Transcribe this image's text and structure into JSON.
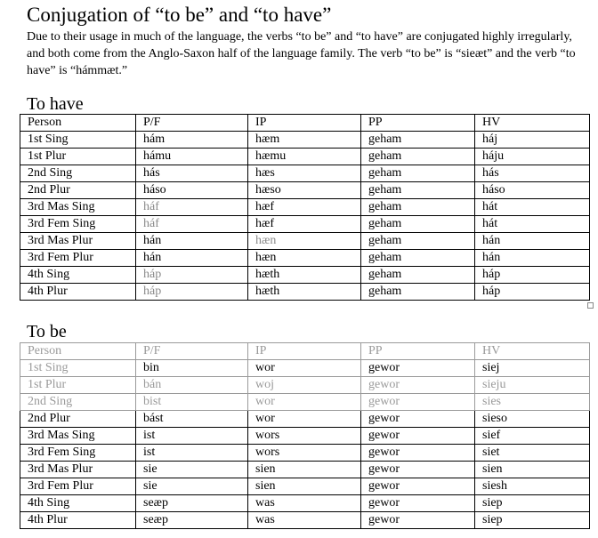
{
  "document": {
    "title": "Conjugation of “to be” and “to have”",
    "intro": "Due to their usage in much of the language, the verbs “to be” and “to have” are conjugated highly irregularly, and both come from the Anglo-Saxon half of the language family. The verb “to be” is “sieæt” and the verb “to have” is “hámmæt.”"
  },
  "tables": [
    {
      "title": "To have",
      "headers": [
        "Person",
        "P/F",
        "IP",
        "PP",
        "HV"
      ],
      "rows": [
        [
          "1st Sing",
          "hám",
          "hæm",
          "geham",
          "háj"
        ],
        [
          "1st Plur",
          "hámu",
          "hæmu",
          "geham",
          "háju"
        ],
        [
          "2nd Sing",
          "hás",
          "hæs",
          "geham",
          "hás"
        ],
        [
          "2nd Plur",
          "háso",
          "hæso",
          "geham",
          "háso"
        ],
        [
          "3rd Mas Sing",
          "háf",
          "hæf",
          "geham",
          "hát"
        ],
        [
          "3rd Fem Sing",
          "háf",
          "hæf",
          "geham",
          "hát"
        ],
        [
          "3rd Mas Plur",
          "hán",
          "hæn",
          "geham",
          "hán"
        ],
        [
          "3rd Fem Plur",
          "hán",
          "hæn",
          "geham",
          "hán"
        ],
        [
          "4th Sing",
          "háp",
          "hæth",
          "geham",
          "háp"
        ],
        [
          "4th Plur",
          "háp",
          "hæth",
          "geham",
          "háp"
        ]
      ]
    },
    {
      "title": "To be",
      "headers": [
        "Person",
        "P/F",
        "IP",
        "PP",
        "HV"
      ],
      "rows": [
        [
          "1st Sing",
          "bin",
          "wor",
          "gewor",
          "siej"
        ],
        [
          "1st Plur",
          "bán",
          "woj",
          "gewor",
          "sieju"
        ],
        [
          "2nd Sing",
          "bist",
          "wor",
          "gewor",
          "sies"
        ],
        [
          "2nd Plur",
          "bást",
          "wor",
          "gewor",
          "sieso"
        ],
        [
          "3rd Mas Sing",
          "ist",
          "wors",
          "gewor",
          "sief"
        ],
        [
          "3rd Fem Sing",
          "ist",
          "wors",
          "gewor",
          "siet"
        ],
        [
          "3rd Mas Plur",
          "sie",
          "sien",
          "gewor",
          "sien"
        ],
        [
          "3rd Fem Plur",
          "sie",
          "sien",
          "gewor",
          "siesh"
        ],
        [
          "4th Sing",
          "seæp",
          "was",
          "gewor",
          "siep"
        ],
        [
          "4th Plur",
          "seæp",
          "was",
          "gewor",
          "siep"
        ]
      ]
    }
  ]
}
